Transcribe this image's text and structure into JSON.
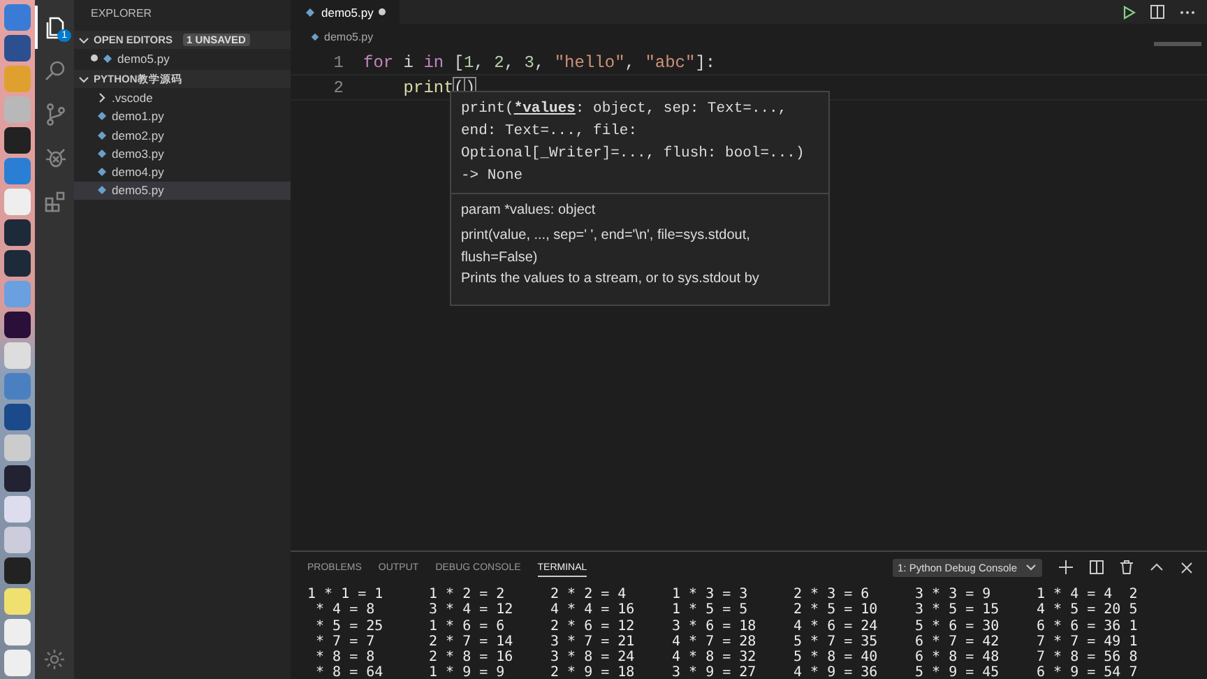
{
  "activity_bar": {
    "items": [
      {
        "kind": "files",
        "selected": true,
        "badge": "1"
      },
      {
        "kind": "search",
        "selected": false
      },
      {
        "kind": "source-control",
        "selected": false
      },
      {
        "kind": "debug",
        "selected": false
      },
      {
        "kind": "extensions",
        "selected": false
      }
    ]
  },
  "sidebar": {
    "title": "EXPLORER",
    "sections": [
      {
        "title": "OPEN EDITORS",
        "badge": "1 UNSAVED",
        "expanded": true,
        "items": [
          {
            "label": "demo5.py",
            "kind": "file",
            "unsaved": true
          }
        ]
      },
      {
        "title": "PYTHON教学源码",
        "expanded": true,
        "items": [
          {
            "label": ".vscode",
            "kind": "folder",
            "expanded": false,
            "selected": false
          },
          {
            "label": "demo1.py",
            "kind": "file",
            "selected": false
          },
          {
            "label": "demo2.py",
            "kind": "file",
            "selected": false
          },
          {
            "label": "demo3.py",
            "kind": "file",
            "selected": false
          },
          {
            "label": "demo4.py",
            "kind": "file",
            "selected": false
          },
          {
            "label": "demo5.py",
            "kind": "file",
            "selected": true
          }
        ]
      }
    ]
  },
  "editor": {
    "tabs": [
      {
        "label": "demo5.py",
        "unsaved": true,
        "selected": true
      }
    ],
    "breadcrumb": "demo5.py",
    "lines": [
      {
        "number": "1",
        "tokens": [
          {
            "kind": "keyword",
            "text": "for"
          },
          {
            "kind": "plain",
            "text": " i "
          },
          {
            "kind": "keyword",
            "text": "in"
          },
          {
            "kind": "plain",
            "text": " ["
          },
          {
            "kind": "number",
            "text": "1"
          },
          {
            "kind": "plain",
            "text": ", "
          },
          {
            "kind": "number",
            "text": "2"
          },
          {
            "kind": "plain",
            "text": ", "
          },
          {
            "kind": "number",
            "text": "3"
          },
          {
            "kind": "plain",
            "text": ", "
          },
          {
            "kind": "string",
            "text": "\"hello\""
          },
          {
            "kind": "plain",
            "text": ", "
          },
          {
            "kind": "string",
            "text": "\"abc\""
          },
          {
            "kind": "plain",
            "text": "]:"
          }
        ]
      },
      {
        "number": "2",
        "tokens": [
          {
            "kind": "indent"
          },
          {
            "kind": "function",
            "text": "print"
          },
          {
            "kind": "bracket",
            "text": "("
          },
          {
            "kind": "cursor"
          },
          {
            "kind": "bracket",
            "text": ")"
          }
        ]
      }
    ],
    "hover": {
      "signature_start": "print(",
      "active_param": "*values",
      "signature_rest": [
        ": object, sep: Text=...,",
        "end: Text=..., file:",
        "Optional[_Writer]=..., flush: bool=...)",
        "-> None"
      ],
      "param": "param *values: object",
      "doc": [
        "print(value, ..., sep=' ', end='\\n', file=sys.stdout, flush=False)",
        "Prints the values to a stream, or to sys.stdout by"
      ]
    }
  },
  "panel": {
    "tabs": [
      {
        "label": "PROBLEMS",
        "selected": false
      },
      {
        "label": "OUTPUT",
        "selected": false
      },
      {
        "label": "DEBUG CONSOLE",
        "selected": false
      },
      {
        "label": "TERMINAL",
        "selected": true
      }
    ],
    "terminal_select": "1: Python Debug Console",
    "terminal_rows": [
      [
        "1 * 1 = 1",
        "1 * 2 = 2",
        "2 * 2 = 4",
        "1 * 3 = 3",
        "2 * 3 = 6",
        "3 * 3 = 9",
        "1 * 4 = 4  2"
      ],
      [
        " * 4 = 8",
        "3 * 4 = 12",
        "4 * 4 = 16",
        "1 * 5 = 5",
        "2 * 5 = 10",
        "3 * 5 = 15",
        "4 * 5 = 20 5"
      ],
      [
        " * 5 = 25",
        "1 * 6 = 6",
        "2 * 6 = 12",
        "3 * 6 = 18",
        "4 * 6 = 24",
        "5 * 6 = 30",
        "6 * 6 = 36 1"
      ],
      [
        " * 7 = 7",
        "2 * 7 = 14",
        "3 * 7 = 21",
        "4 * 7 = 28",
        "5 * 7 = 35",
        "6 * 7 = 42",
        "7 * 7 = 49 1"
      ],
      [
        " * 8 = 8",
        "2 * 8 = 16",
        "3 * 8 = 24",
        "4 * 8 = 32",
        "5 * 8 = 40",
        "6 * 8 = 48",
        "7 * 8 = 56 8"
      ],
      [
        " * 8 = 64",
        "1 * 9 = 9",
        "2 * 9 = 18",
        "3 * 9 = 27",
        "4 * 9 = 36",
        "5 * 9 = 45",
        "6 * 9 = 54 7"
      ]
    ]
  }
}
